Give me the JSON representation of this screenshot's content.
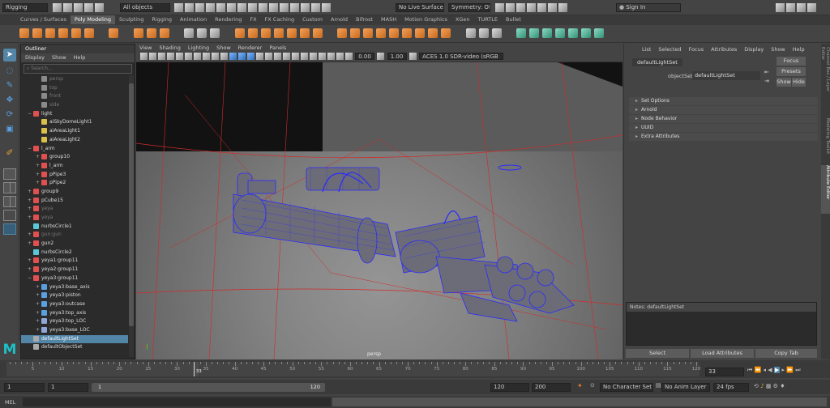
{
  "toolbar": {
    "menuset": "Rigging",
    "objects": "All objects",
    "live_surface": "No Live Surface",
    "symmetry": "Symmetry: Off",
    "signin": "Sign In"
  },
  "shelf_tabs": [
    "Curves / Surfaces",
    "Poly Modeling",
    "Sculpting",
    "Rigging",
    "Animation",
    "Rendering",
    "FX",
    "FX Caching",
    "Custom",
    "Arnold",
    "Bifrost",
    "MASH",
    "Motion Graphics",
    "XGen",
    "TURTLE",
    "Bullet"
  ],
  "shelf_active": 1,
  "outliner": {
    "title": "Outliner",
    "menu": [
      "Display",
      "Show",
      "Help"
    ],
    "search_placeholder": "Search...",
    "items": [
      {
        "label": "persp",
        "indent": 1,
        "dim": true,
        "icon": "camera"
      },
      {
        "label": "top",
        "indent": 1,
        "dim": true,
        "icon": "camera"
      },
      {
        "label": "front",
        "indent": 1,
        "dim": true,
        "icon": "camera"
      },
      {
        "label": "side",
        "indent": 1,
        "dim": true,
        "icon": "camera"
      },
      {
        "label": "light",
        "indent": 0,
        "dim": false,
        "icon": "group",
        "expand": "−"
      },
      {
        "label": "aiSkyDomeLight1",
        "indent": 1,
        "dim": false,
        "icon": "light"
      },
      {
        "label": "aiAreaLight1",
        "indent": 1,
        "dim": false,
        "icon": "light"
      },
      {
        "label": "aiAreaLight2",
        "indent": 1,
        "dim": false,
        "icon": "light"
      },
      {
        "label": "l_arm",
        "indent": 0,
        "dim": false,
        "icon": "group",
        "expand": "−"
      },
      {
        "label": "group10",
        "indent": 1,
        "dim": false,
        "icon": "group",
        "expand": "+"
      },
      {
        "label": "l_arm",
        "indent": 1,
        "dim": false,
        "icon": "mesh",
        "expand": "+"
      },
      {
        "label": "pPipe3",
        "indent": 1,
        "dim": false,
        "icon": "mesh",
        "expand": "+"
      },
      {
        "label": "pPipe2",
        "indent": 1,
        "dim": false,
        "icon": "mesh",
        "expand": "+"
      },
      {
        "label": "group9",
        "indent": 0,
        "dim": false,
        "icon": "group",
        "expand": "+"
      },
      {
        "label": "pCube15",
        "indent": 0,
        "dim": false,
        "icon": "mesh",
        "expand": "+"
      },
      {
        "label": "yeya",
        "indent": 0,
        "dim": true,
        "icon": "group",
        "expand": "+"
      },
      {
        "label": "yeya",
        "indent": 0,
        "dim": true,
        "icon": "group",
        "expand": "+"
      },
      {
        "label": "nurbsCircle1",
        "indent": 0,
        "dim": false,
        "icon": "curve"
      },
      {
        "label": "gun:gun",
        "indent": 0,
        "dim": true,
        "icon": "group",
        "expand": "+"
      },
      {
        "label": "gun2",
        "indent": 0,
        "dim": false,
        "icon": "group",
        "expand": "+"
      },
      {
        "label": "nurbsCircle2",
        "indent": 0,
        "dim": false,
        "icon": "curve"
      },
      {
        "label": "yeya1:group11",
        "indent": 0,
        "dim": false,
        "icon": "group",
        "expand": "+"
      },
      {
        "label": "yeya2:group11",
        "indent": 0,
        "dim": false,
        "icon": "group",
        "expand": "+"
      },
      {
        "label": "yeya3:group11",
        "indent": 0,
        "dim": false,
        "icon": "group",
        "expand": "−"
      },
      {
        "label": "yeya3:base_axis",
        "indent": 1,
        "dim": false,
        "icon": "joint",
        "expand": "+"
      },
      {
        "label": "yeya3:piston",
        "indent": 1,
        "dim": false,
        "icon": "joint",
        "expand": "+"
      },
      {
        "label": "yeya3:outcase",
        "indent": 1,
        "dim": false,
        "icon": "joint",
        "expand": "+"
      },
      {
        "label": "yeya3:top_axis",
        "indent": 1,
        "dim": false,
        "icon": "joint",
        "expand": "+"
      },
      {
        "label": "yeya3:top_LOC",
        "indent": 1,
        "dim": false,
        "icon": "locator",
        "expand": "+"
      },
      {
        "label": "yeya3:base_LOC",
        "indent": 1,
        "dim": false,
        "icon": "locator",
        "expand": "+"
      },
      {
        "label": "defaultLightSet",
        "indent": 0,
        "dim": false,
        "icon": "set",
        "selected": true
      },
      {
        "label": "defaultObjectSet",
        "indent": 0,
        "dim": false,
        "icon": "set"
      }
    ]
  },
  "viewport": {
    "menu": [
      "View",
      "Shading",
      "Lighting",
      "Show",
      "Renderer",
      "Panels"
    ],
    "exposure": "0.00",
    "gamma": "1.00",
    "colorspace": "ACES 1.0 SDR-video (sRGB",
    "camera_label": "persp"
  },
  "attr_editor": {
    "menu": [
      "List",
      "Selected",
      "Focus",
      "Attributes",
      "Display",
      "Show",
      "Help"
    ],
    "node_tab": "defaultLightSet",
    "objectset_label": "objectSet:",
    "objectset_value": "defaultLightSet",
    "focus": "Focus",
    "presets": "Presets",
    "show": "Show",
    "hide": "Hide",
    "sections": [
      "Set Options",
      "Arnold",
      "Node Behavior",
      "UUID",
      "Extra Attributes"
    ],
    "notes": "Notes:  defaultLightSet",
    "select": "Select",
    "load_attributes": "Load Attributes",
    "copy_tab": "Copy Tab",
    "side_tabs": [
      "Channel Box / Layer Editor",
      "Modeling Toolkit",
      "Attribute Editor"
    ]
  },
  "timeline": {
    "ticks": [
      "5",
      "10",
      "15",
      "20",
      "25",
      "30",
      "35",
      "40",
      "45",
      "50",
      "55",
      "60",
      "65",
      "70",
      "75",
      "80",
      "85",
      "90",
      "95",
      "100",
      "105",
      "110",
      "115",
      "120"
    ],
    "current_frame_marker": "33",
    "current_frame": "33",
    "range_start": "1",
    "range_start2": "1",
    "range_slider_start": "1",
    "range_slider_end": "120",
    "range_end": "120",
    "range_end2": "200",
    "character_set": "No Character Set",
    "anim_layer": "No Anim Layer",
    "fps": "24 fps"
  },
  "command_line": {
    "label": "MEL"
  },
  "colors": {
    "selection": "#5285a6",
    "wire": "#2a2aff",
    "accent": "#f39c42"
  }
}
